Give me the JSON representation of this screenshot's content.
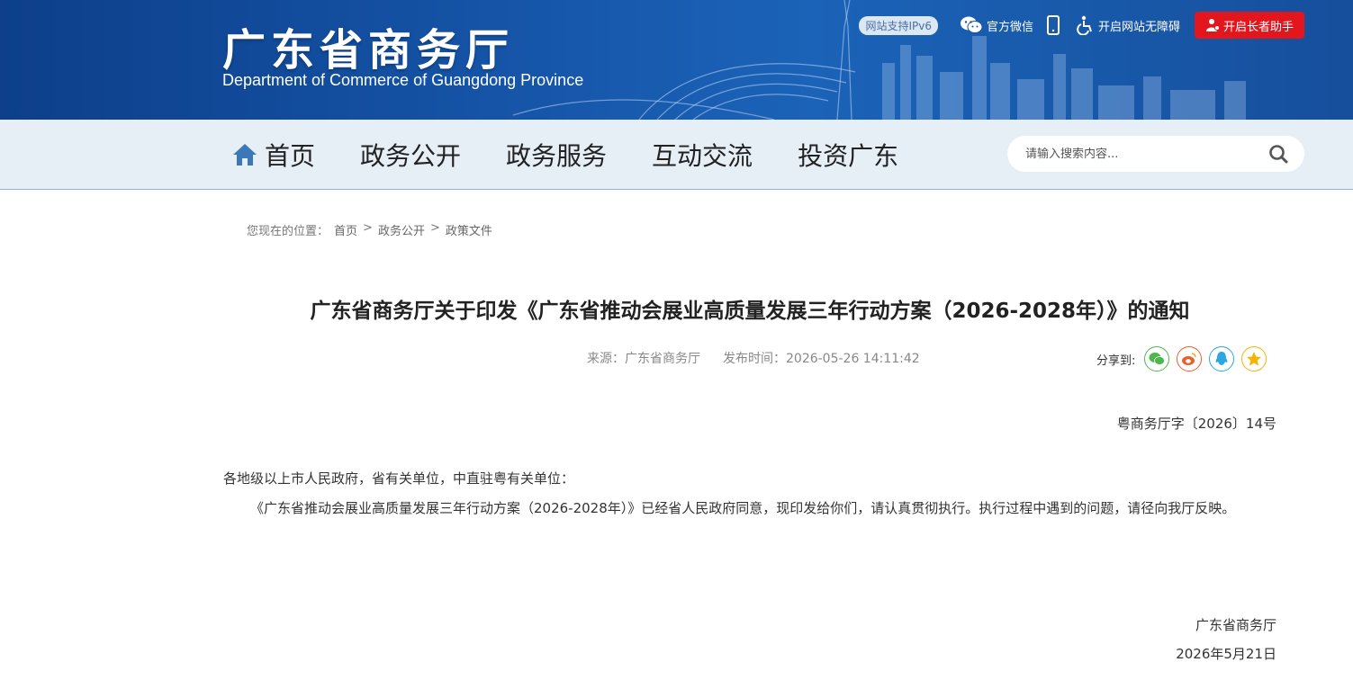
{
  "header": {
    "site_title": "广东省商务厅",
    "site_subtitle": "Department of Commerce of Guangdong Province",
    "ipv6_badge": "网站支持IPv6",
    "wechat_label": "官方微信",
    "accessibility_label": "开启网站无障碍",
    "elder_label": "开启长者助手"
  },
  "nav": {
    "items": [
      "首页",
      "政务公开",
      "政务服务",
      "互动交流",
      "投资广东"
    ],
    "search_placeholder": "请输入搜索内容..."
  },
  "breadcrumb": {
    "prefix": "您现在的位置：",
    "items": [
      "首页",
      "政务公开",
      "政策文件"
    ],
    "separator": ">"
  },
  "article": {
    "title": "广东省商务厅关于印发《广东省推动会展业高质量发展三年行动方案（2026-2028年）》的通知",
    "source": "来源：广东省商务厅",
    "publish_time": "发布时间：2026-05-26 14:11:42",
    "share_label": "分享到:",
    "doc_number": "粤商务厅字〔2026〕14号",
    "salutation": "各地级以上市人民政府，省有关单位，中直驻粤有关单位：",
    "paragraph": "《广东省推动会展业高质量发展三年行动方案（2026-2028年）》已经省人民政府同意，现印发给你们，请认真贯彻执行。执行过程中遇到的问题，请径向我厅反映。",
    "signature_org": "广东省商务厅",
    "signature_date": "2026年5月21日"
  },
  "share_icons": [
    "wechat-share-icon",
    "weibo-share-icon",
    "qq-share-icon",
    "qzone-share-icon"
  ],
  "colors": {
    "banner": "#1553a6",
    "nav_bg": "#e6eef6",
    "elder_button": "#e3161e",
    "wechat": "#4cb84c",
    "weibo": "#e8602c",
    "qq": "#2ba8e0",
    "qzone": "#f5b400"
  }
}
